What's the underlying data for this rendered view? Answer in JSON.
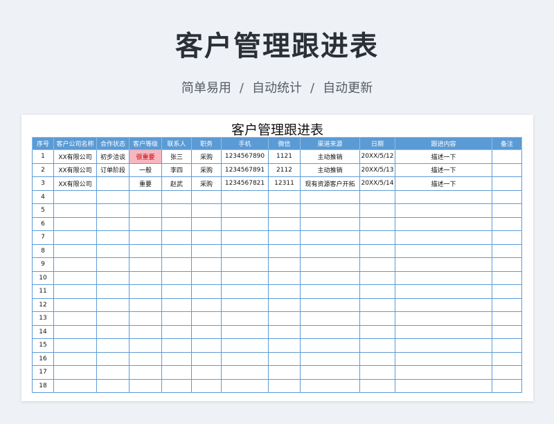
{
  "hero": {
    "title": "客户管理跟进表",
    "subtitle_parts": [
      "简单易用",
      "自动统计",
      "自动更新"
    ],
    "separator": "/"
  },
  "sheet": {
    "title": "客户管理跟进表",
    "headers": [
      "序号",
      "客户公司名称",
      "合作状态",
      "客户等级",
      "联系人",
      "职务",
      "手机",
      "微信",
      "渠道来源",
      "日期",
      "跟进内容",
      "备注"
    ],
    "rows": [
      [
        "1",
        "XX有限公司",
        "初步洽谈",
        "很重要",
        "张三",
        "采购",
        "1234567890",
        "1121",
        "主动推销",
        "20XX/5/12",
        "描述一下",
        ""
      ],
      [
        "2",
        "XX有限公司",
        "订单阶段",
        "一般",
        "李四",
        "采购",
        "1234567891",
        "2112",
        "主动推销",
        "20XX/5/13",
        "描述一下",
        ""
      ],
      [
        "3",
        "XX有限公司",
        "",
        "重要",
        "赵武",
        "采购",
        "1234567821",
        "12311",
        "现有资源客户开拓",
        "20XX/5/14",
        "描述一下",
        ""
      ],
      [
        "4",
        "",
        "",
        "",
        "",
        "",
        "",
        "",
        "",
        "",
        "",
        ""
      ],
      [
        "5",
        "",
        "",
        "",
        "",
        "",
        "",
        "",
        "",
        "",
        "",
        ""
      ],
      [
        "6",
        "",
        "",
        "",
        "",
        "",
        "",
        "",
        "",
        "",
        "",
        ""
      ],
      [
        "7",
        "",
        "",
        "",
        "",
        "",
        "",
        "",
        "",
        "",
        "",
        ""
      ],
      [
        "8",
        "",
        "",
        "",
        "",
        "",
        "",
        "",
        "",
        "",
        "",
        ""
      ],
      [
        "9",
        "",
        "",
        "",
        "",
        "",
        "",
        "",
        "",
        "",
        "",
        ""
      ],
      [
        "10",
        "",
        "",
        "",
        "",
        "",
        "",
        "",
        "",
        "",
        "",
        ""
      ],
      [
        "11",
        "",
        "",
        "",
        "",
        "",
        "",
        "",
        "",
        "",
        "",
        ""
      ],
      [
        "12",
        "",
        "",
        "",
        "",
        "",
        "",
        "",
        "",
        "",
        "",
        ""
      ],
      [
        "13",
        "",
        "",
        "",
        "",
        "",
        "",
        "",
        "",
        "",
        "",
        ""
      ],
      [
        "14",
        "",
        "",
        "",
        "",
        "",
        "",
        "",
        "",
        "",
        "",
        ""
      ],
      [
        "15",
        "",
        "",
        "",
        "",
        "",
        "",
        "",
        "",
        "",
        "",
        ""
      ],
      [
        "16",
        "",
        "",
        "",
        "",
        "",
        "",
        "",
        "",
        "",
        "",
        ""
      ],
      [
        "17",
        "",
        "",
        "",
        "",
        "",
        "",
        "",
        "",
        "",
        "",
        ""
      ],
      [
        "18",
        "",
        "",
        "",
        "",
        "",
        "",
        "",
        "",
        "",
        "",
        ""
      ]
    ],
    "highlight": {
      "row": 0,
      "col": 3,
      "fill": "#f7b7bf",
      "text_color": "#cc0000"
    },
    "colors": {
      "header_bg": "#5b9bd5",
      "grid_line": "#5b9bd5"
    }
  }
}
